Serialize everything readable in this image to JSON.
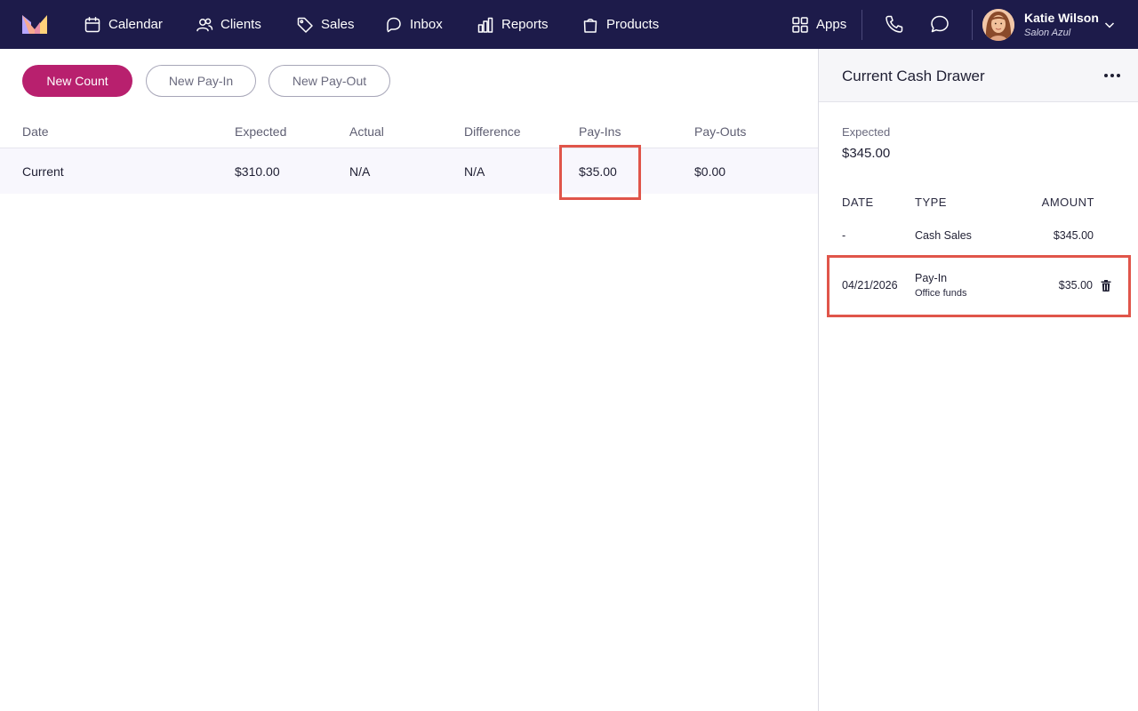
{
  "nav": {
    "items": [
      {
        "label": "Calendar",
        "icon": "calendar-icon"
      },
      {
        "label": "Clients",
        "icon": "users-icon"
      },
      {
        "label": "Sales",
        "icon": "tag-icon"
      },
      {
        "label": "Inbox",
        "icon": "inbox-icon"
      },
      {
        "label": "Reports",
        "icon": "bar-chart-icon"
      },
      {
        "label": "Products",
        "icon": "shopping-bag-icon"
      }
    ],
    "apps_label": "Apps",
    "user": {
      "name": "Katie Wilson",
      "business": "Salon Azul"
    }
  },
  "toolbar": {
    "new_count": "New Count",
    "new_pay_in": "New Pay-In",
    "new_pay_out": "New Pay-Out"
  },
  "table": {
    "headers": [
      "Date",
      "Expected",
      "Actual",
      "Difference",
      "Pay-Ins",
      "Pay-Outs"
    ],
    "rows": [
      [
        "Current",
        "$310.00",
        "N/A",
        "N/A",
        "$35.00",
        "$0.00"
      ]
    ]
  },
  "panel": {
    "title": "Current Cash Drawer",
    "expected_label": "Expected",
    "expected_value": "$345.00",
    "headers": [
      "DATE",
      "TYPE",
      "AMOUNT"
    ],
    "rows": [
      {
        "date": "-",
        "type": "Cash Sales",
        "note": "",
        "amount": "$345.00"
      },
      {
        "date": "04/21/2026",
        "type": "Pay-In",
        "note": "Office funds",
        "amount": "$35.00"
      }
    ]
  },
  "colors": {
    "nav_bg": "#1d1b4a",
    "primary": "#b8206e",
    "highlight": "#e0554a",
    "row_bg": "#f8f7fd"
  }
}
